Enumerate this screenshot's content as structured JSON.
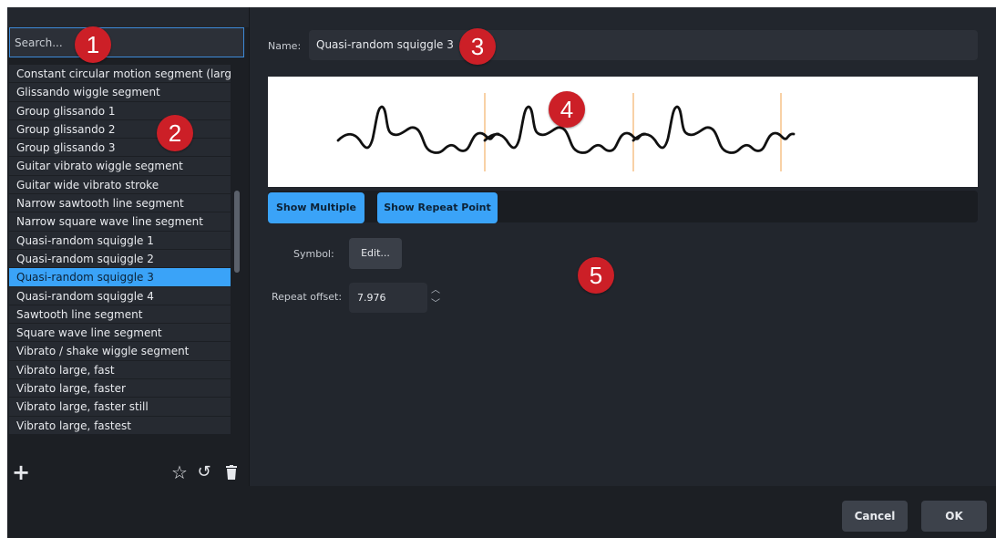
{
  "search": {
    "placeholder": "Search..."
  },
  "list": {
    "items": [
      "Constant circular motion segment (large)",
      "Glissando wiggle segment",
      "Group glissando 1",
      "Group glissando 2",
      "Group glissando 3",
      "Guitar vibrato wiggle segment",
      "Guitar wide vibrato stroke",
      "Narrow sawtooth line segment",
      "Narrow square wave line segment",
      "Quasi-random squiggle 1",
      "Quasi-random squiggle 2",
      "Quasi-random squiggle 3",
      "Quasi-random squiggle 4",
      "Sawtooth line segment",
      "Square wave line segment",
      "Vibrato / shake wiggle segment",
      "Vibrato large, fast",
      "Vibrato large, faster",
      "Vibrato large, faster still",
      "Vibrato large, fastest"
    ],
    "selected_index": 11
  },
  "left_toolbar": {
    "add_icon": "plus-icon",
    "star_icon": "star-icon",
    "revert_icon": "revert-icon",
    "delete_icon": "trash-icon"
  },
  "editor": {
    "name_label": "Name:",
    "name_value": "Quasi-random squiggle 3",
    "show_multiple_label": "Show Multiple",
    "show_repeat_point_label": "Show Repeat Point",
    "symbol_label": "Symbol:",
    "edit_button_label": "Edit...",
    "repeat_offset_label": "Repeat offset:",
    "repeat_offset_value": "7.976"
  },
  "footer": {
    "cancel_label": "Cancel",
    "ok_label": "OK"
  },
  "callouts": [
    "1",
    "2",
    "3",
    "4",
    "5"
  ],
  "colors": {
    "accent": "#3aa3f8",
    "background": "#22262d",
    "callout": "#cc1f27",
    "repeat_marker": "#f2b26b"
  }
}
